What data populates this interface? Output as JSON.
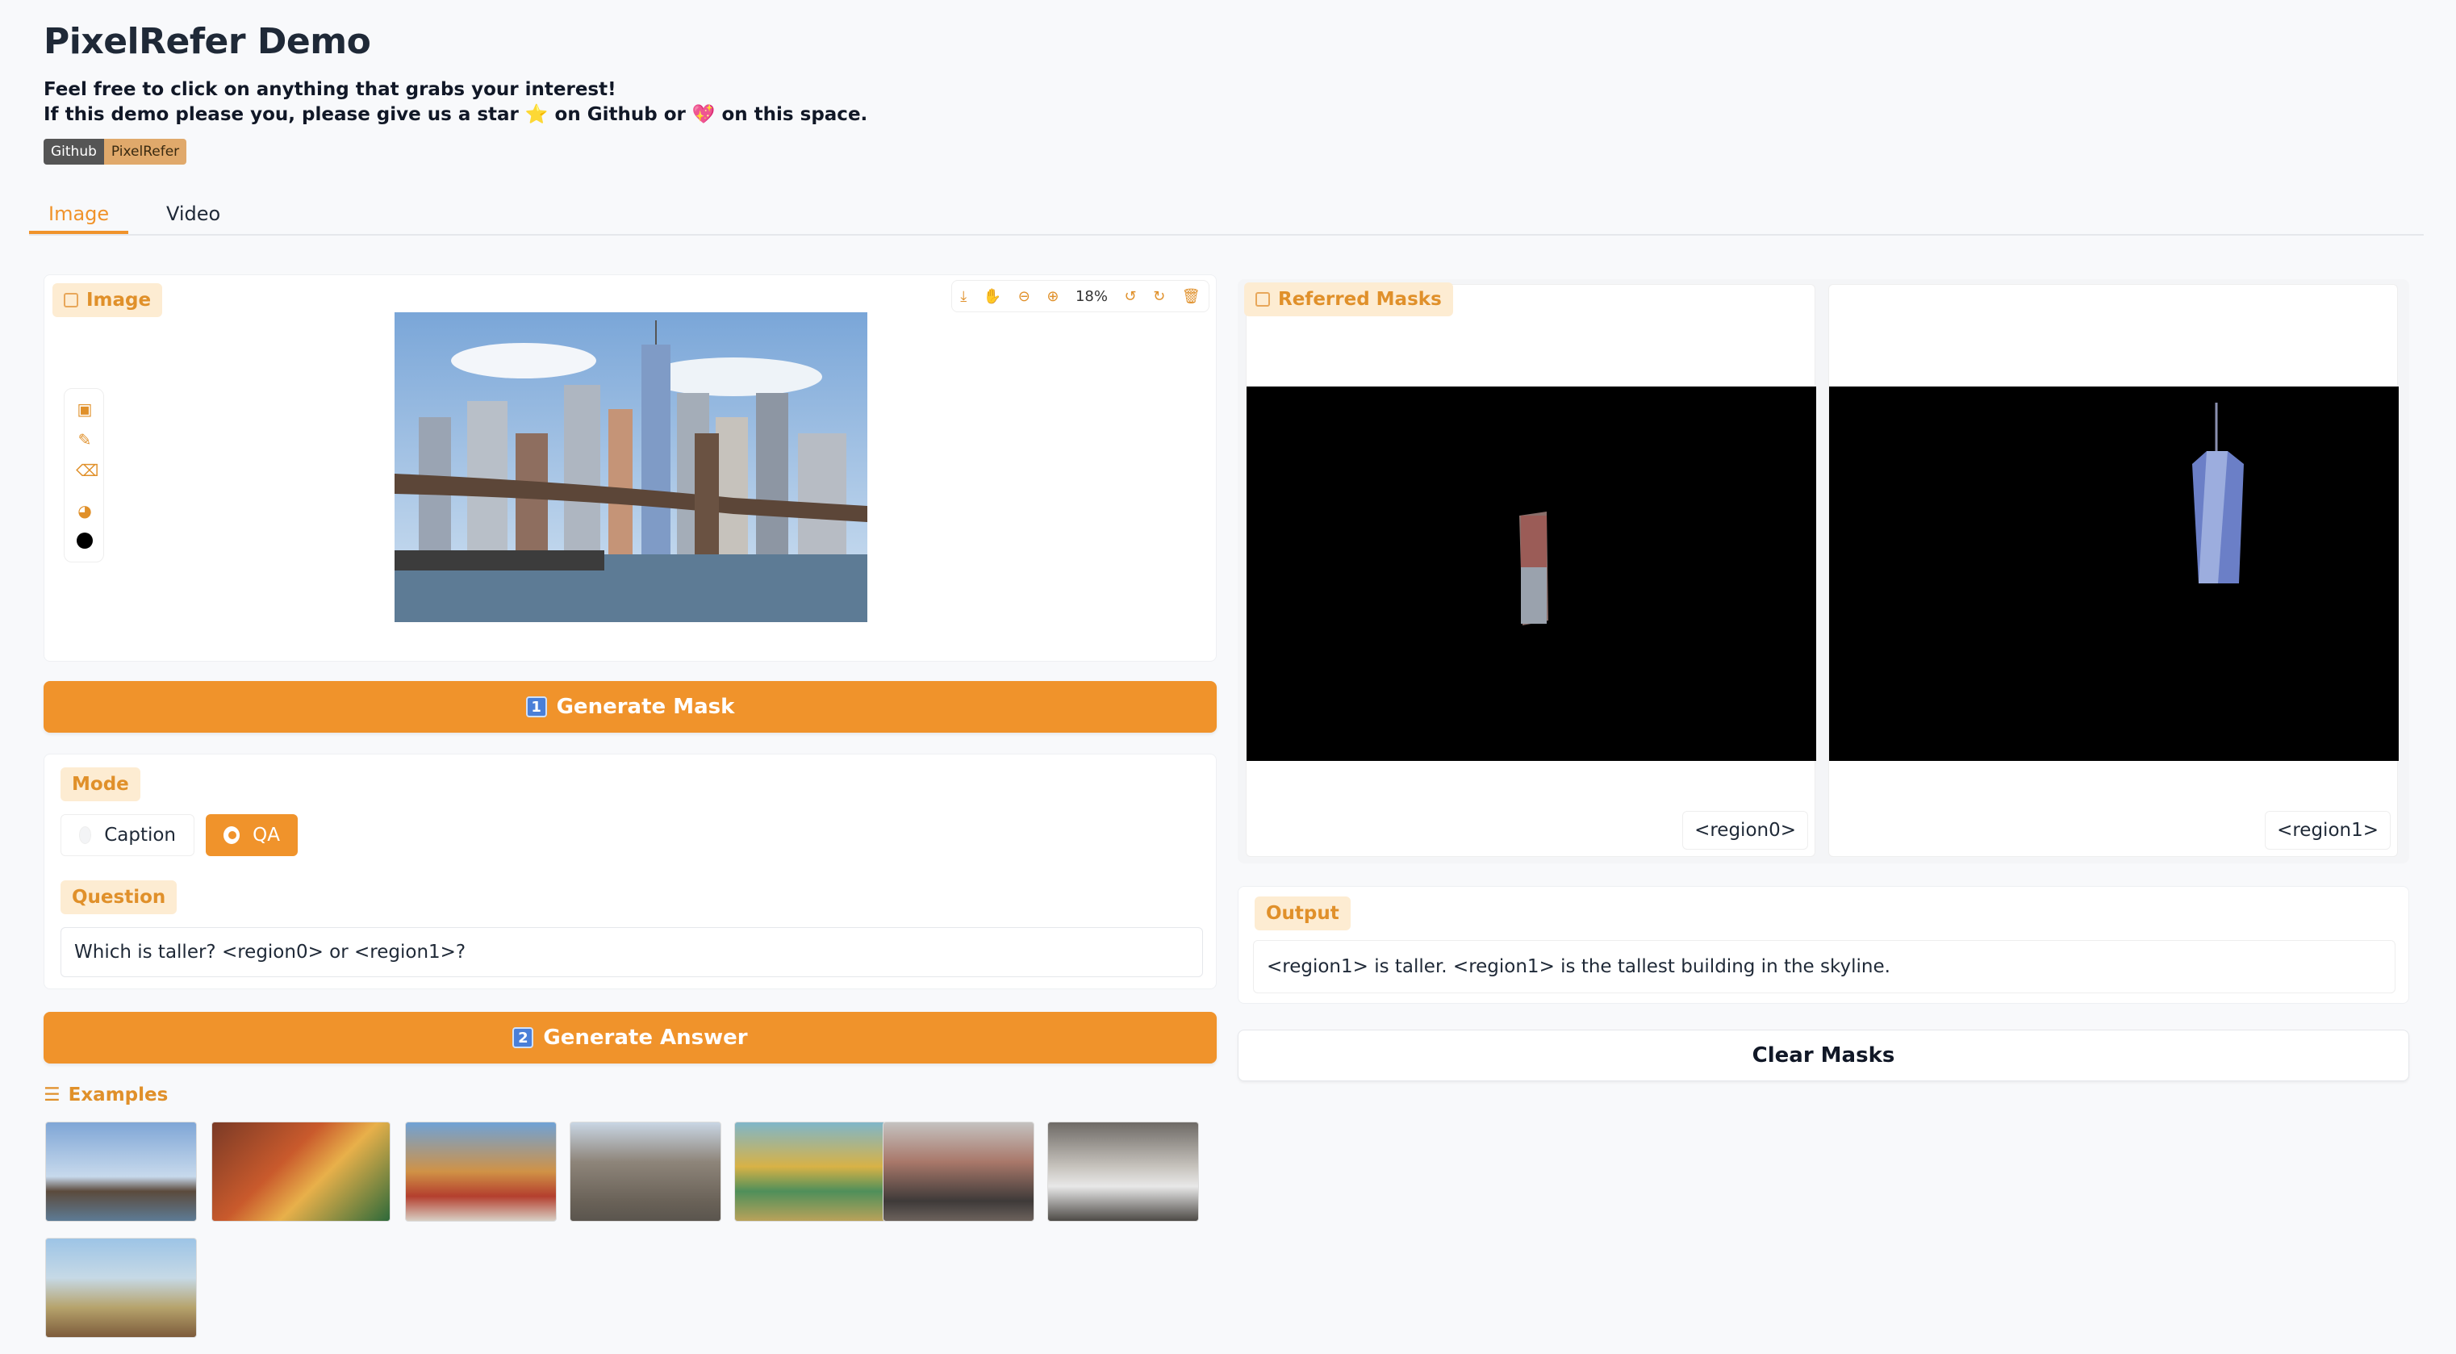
{
  "header": {
    "title": "PixelRefer Demo",
    "line1": "Feel free to click on anything that grabs your interest!",
    "line2": "If this demo please you, please give us a star ⭐ on Github or 💖 on this space.",
    "badge_left": "Github",
    "badge_right": "PixelRefer"
  },
  "tabs": [
    {
      "label": "Image",
      "active": true
    },
    {
      "label": "Video",
      "active": false
    }
  ],
  "image_panel": {
    "label": "Image",
    "zoom": "18%",
    "toolbar_icons": [
      "download-icon",
      "pan-icon",
      "zoom-out-icon",
      "zoom-in-icon",
      "undo-icon",
      "redo-icon",
      "trash-icon"
    ],
    "draw_tools": [
      "image-tool-icon",
      "brush-icon",
      "eraser-icon",
      "palette-icon",
      "color-swatch-icon"
    ]
  },
  "buttons": {
    "generate_mask": "Generate Mask",
    "generate_mask_num": "1",
    "generate_answer": "Generate Answer",
    "generate_answer_num": "2",
    "clear_masks": "Clear Masks"
  },
  "mode": {
    "label": "Mode",
    "options": [
      "Caption",
      "QA"
    ],
    "selected": "QA"
  },
  "question": {
    "label": "Question",
    "value": "Which is taller?  <region0> or <region1>?"
  },
  "examples": {
    "label": "Examples",
    "count": 8
  },
  "masks": {
    "label": "Referred Masks",
    "items": [
      {
        "tag": "<region0>"
      },
      {
        "tag": "<region1>"
      }
    ]
  },
  "output": {
    "label": "Output",
    "value": "<region1> is taller. <region1> is the tallest building in the skyline."
  },
  "colors": {
    "accent": "#f0932b",
    "label_bg": "#fdecd2",
    "label_text": "#e0902a"
  }
}
